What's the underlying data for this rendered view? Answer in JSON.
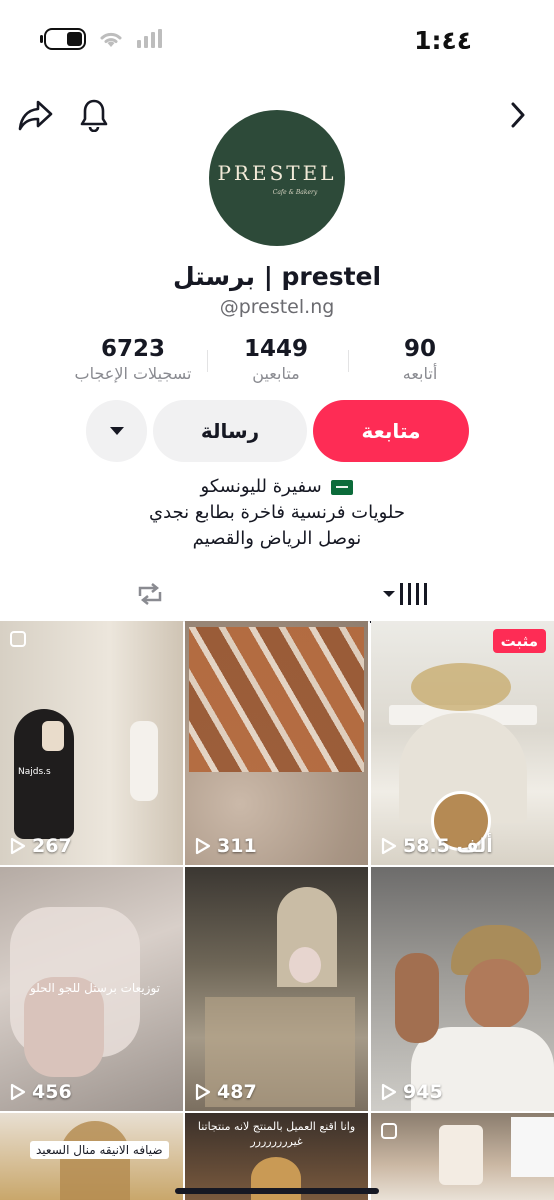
{
  "status_bar": {
    "time": "1:٤٤"
  },
  "profile": {
    "display_name": "برستل | prestel",
    "username": "@prestel.ng",
    "avatar_logo_text": "PRESTEL",
    "avatar_tagline": "Cafe & Bakery"
  },
  "stats": [
    {
      "value": "6723",
      "label": "تسجيلات الإعجاب"
    },
    {
      "value": "1449",
      "label": "متابعين"
    },
    {
      "value": "90",
      "label": "أتابعه"
    }
  ],
  "actions": {
    "follow": "متابعة",
    "message": "رسالة"
  },
  "bio": {
    "line1": "سفيرة  لليونسكو",
    "line2": "حلويات فرنسية فاخرة بطابع نجدي",
    "line3": "نوصل الرياض والقصيم"
  },
  "videos": [
    {
      "views": "58.5 ألف",
      "pinned_label": "مثبت"
    },
    {
      "views": "311"
    },
    {
      "views": "267",
      "overlay": "Najds.s"
    },
    {
      "views": "945"
    },
    {
      "views": "487"
    },
    {
      "views": "456",
      "overlay": "توزيعات برستل للجو الحلو"
    },
    {
      "views": ""
    },
    {
      "views": "",
      "overlay": "وانا اقنع العميل بالمنتج لانه منتجاتنا  غيرررررررر"
    },
    {
      "views": "",
      "overlay": "ضيافه الانيقه منال السعيد"
    }
  ],
  "colors": {
    "accent": "#fe2c55",
    "avatar_bg": "#2d4a39"
  }
}
